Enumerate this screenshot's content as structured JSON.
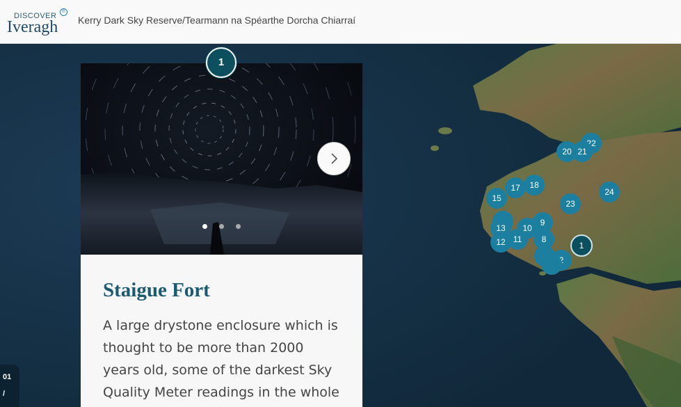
{
  "header": {
    "logo_small": "DISCOVER",
    "logo_big": "Iveragh",
    "logo_badge": "®",
    "title": "Kerry Dark Sky Reserve/Tearmann na Spéarthe Dorcha Chiarraí"
  },
  "story": {
    "active_pin": "1",
    "place_title": "Staigue Fort",
    "description": "A large drystone enclosure which is thought to be more than 2000 years old, some of the darkest Sky Quality Meter readings in the whole of the",
    "gallery": {
      "image_count": 3,
      "current_index": 1
    }
  },
  "map": {
    "markers": [
      {
        "label": "22"
      },
      {
        "label": "20"
      },
      {
        "label": "21"
      },
      {
        "label": "17"
      },
      {
        "label": "18"
      },
      {
        "label": "24"
      },
      {
        "label": "15"
      },
      {
        "label": "23"
      },
      {
        "label": "·"
      },
      {
        "label": "13"
      },
      {
        "label": "10"
      },
      {
        "label": "9"
      },
      {
        "label": "12"
      },
      {
        "label": "11"
      },
      {
        "label": "8"
      },
      {
        "label": ""
      },
      {
        "label": "2"
      }
    ],
    "active_marker": "1"
  },
  "counter": {
    "current": "01",
    "separator": "/"
  },
  "colors": {
    "marker": "#1d7fa0",
    "marker_active": "#0c4f5e",
    "title": "#1c5a70",
    "sea": "#15324a"
  }
}
